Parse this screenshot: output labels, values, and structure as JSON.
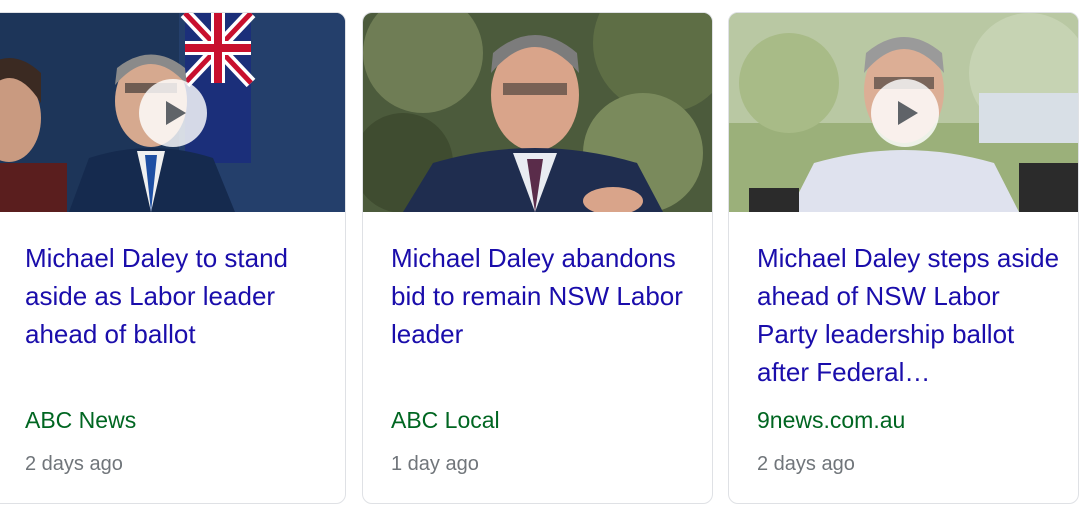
{
  "cards": [
    {
      "headline": "Michael Daley to stand aside as Labor leader ahead of ballot",
      "source": "ABC News",
      "time": "2 days ago",
      "has_video": true,
      "thumbnail": "photo-man-speaking-at-press-conference-with-flag"
    },
    {
      "headline": "Michael Daley abandons bid to remain NSW Labor leader",
      "source": "ABC Local",
      "time": "1 day ago",
      "has_video": false,
      "thumbnail": "photo-man-speaking-outdoors-in-suit"
    },
    {
      "headline": "Michael Daley steps aside ahead of NSW Labor Party leadership ballot after Federal…",
      "source": "9news.com.au",
      "time": "2 days ago",
      "has_video": true,
      "thumbnail": "photo-man-speaking-to-microphones-outdoors"
    }
  ],
  "colors": {
    "headline": "#1a0dab",
    "source": "#006621",
    "time": "#70757a",
    "card_border": "#dfe1e5"
  }
}
